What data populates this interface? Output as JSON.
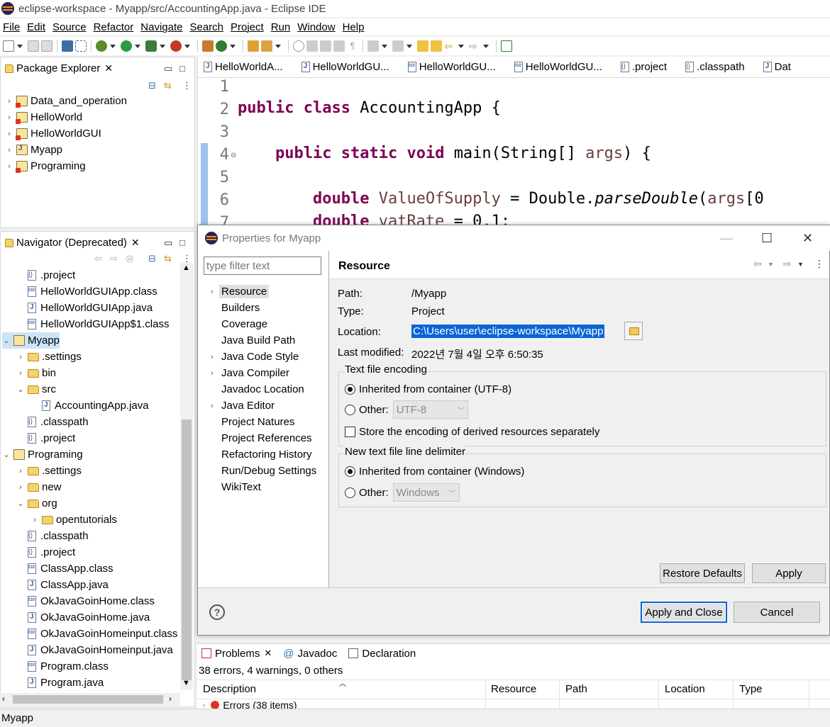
{
  "window": {
    "title": "eclipse-workspace - Myapp/src/AccountingApp.java - Eclipse IDE"
  },
  "menu": [
    "File",
    "Edit",
    "Source",
    "Refactor",
    "Navigate",
    "Search",
    "Project",
    "Run",
    "Window",
    "Help"
  ],
  "package_explorer": {
    "tab_label": "Package Explorer",
    "items": [
      {
        "label": "Data_and_operation",
        "icon": "project-error-icon"
      },
      {
        "label": "HelloWorld",
        "icon": "project-error-icon"
      },
      {
        "label": "HelloWorldGUI",
        "icon": "project-error-icon"
      },
      {
        "label": "Myapp",
        "icon": "java-project-icon"
      },
      {
        "label": "Programing",
        "icon": "project-error-icon"
      }
    ]
  },
  "navigator": {
    "tab_label": "Navigator (Deprecated)",
    "items": [
      {
        "label": ".project",
        "indent": 1,
        "icon": "xml",
        "twisty": ""
      },
      {
        "label": "HelloWorldGUIApp.class",
        "indent": 1,
        "icon": "cls",
        "twisty": ""
      },
      {
        "label": "HelloWorldGUIApp.java",
        "indent": 1,
        "icon": "java",
        "twisty": ""
      },
      {
        "label": "HelloWorldGUIApp$1.class",
        "indent": 1,
        "icon": "cls",
        "twisty": ""
      },
      {
        "label": "Myapp",
        "indent": 0,
        "icon": "project",
        "twisty": "open"
      },
      {
        "label": ".settings",
        "indent": 1,
        "icon": "folder",
        "twisty": "closed"
      },
      {
        "label": "bin",
        "indent": 1,
        "icon": "folder",
        "twisty": "closed"
      },
      {
        "label": "src",
        "indent": 1,
        "icon": "folder",
        "twisty": "open"
      },
      {
        "label": "AccountingApp.java",
        "indent": 2,
        "icon": "java",
        "twisty": ""
      },
      {
        "label": ".classpath",
        "indent": 1,
        "icon": "xml",
        "twisty": ""
      },
      {
        "label": ".project",
        "indent": 1,
        "icon": "xml",
        "twisty": ""
      },
      {
        "label": "Programing",
        "indent": 0,
        "icon": "project",
        "twisty": "open"
      },
      {
        "label": ".settings",
        "indent": 1,
        "icon": "folder",
        "twisty": "closed"
      },
      {
        "label": "new",
        "indent": 1,
        "icon": "folder",
        "twisty": "closed"
      },
      {
        "label": "org",
        "indent": 1,
        "icon": "folder",
        "twisty": "open"
      },
      {
        "label": "opentutorials",
        "indent": 2,
        "icon": "folder",
        "twisty": "closed"
      },
      {
        "label": ".classpath",
        "indent": 1,
        "icon": "xml",
        "twisty": ""
      },
      {
        "label": ".project",
        "indent": 1,
        "icon": "xml",
        "twisty": ""
      },
      {
        "label": "ClassApp.class",
        "indent": 1,
        "icon": "cls",
        "twisty": ""
      },
      {
        "label": "ClassApp.java",
        "indent": 1,
        "icon": "java",
        "twisty": ""
      },
      {
        "label": "OkJavaGoinHome.class",
        "indent": 1,
        "icon": "cls",
        "twisty": ""
      },
      {
        "label": "OkJavaGoinHome.java",
        "indent": 1,
        "icon": "java",
        "twisty": ""
      },
      {
        "label": "OkJavaGoinHomeinput.class",
        "indent": 1,
        "icon": "cls",
        "twisty": ""
      },
      {
        "label": "OkJavaGoinHomeinput.java",
        "indent": 1,
        "icon": "java",
        "twisty": ""
      },
      {
        "label": "Program.class",
        "indent": 1,
        "icon": "cls",
        "twisty": ""
      },
      {
        "label": "Program.java",
        "indent": 1,
        "icon": "java",
        "twisty": ""
      }
    ]
  },
  "editor": {
    "tabs": [
      {
        "label": "HelloWorldA...",
        "icon": "java"
      },
      {
        "label": "HelloWorldGU...",
        "icon": "java"
      },
      {
        "label": "HelloWorldGU...",
        "icon": "cls"
      },
      {
        "label": "HelloWorldGU...",
        "icon": "cls"
      },
      {
        "label": ".project",
        "icon": "xml"
      },
      {
        "label": ".classpath",
        "icon": "xml"
      },
      {
        "label": "Dat",
        "icon": "java"
      }
    ],
    "line_numbers": [
      "1",
      "2",
      "3",
      "4",
      "5",
      "6",
      "7"
    ],
    "line2": {
      "kw1": "public",
      "kw2": "class",
      "rest": "AccountingApp {"
    },
    "line4": {
      "kw1": "public",
      "kw2": "static",
      "kw3": "void",
      "rest1": "main(String[] ",
      "arg": "args",
      "rest2": ") {"
    },
    "line6": {
      "kw": "double",
      "var": "ValueOfSupply",
      "rest1": " = Double.",
      "method": "parseDouble",
      "rest2": "(",
      "arg": "args",
      "rest3": "[0"
    },
    "line7": {
      "kw": "double",
      "var": "vatRate",
      "rest": " = 0.1;"
    }
  },
  "dialog": {
    "title": "Properties for Myapp",
    "filter_placeholder": "type filter text",
    "nav": [
      {
        "label": "Resource",
        "twisty": ">",
        "selected": true
      },
      {
        "label": "Builders",
        "twisty": "",
        "selected": false
      },
      {
        "label": "Coverage",
        "twisty": "",
        "selected": false
      },
      {
        "label": "Java Build Path",
        "twisty": "",
        "selected": false
      },
      {
        "label": "Java Code Style",
        "twisty": ">",
        "selected": false
      },
      {
        "label": "Java Compiler",
        "twisty": ">",
        "selected": false
      },
      {
        "label": "Javadoc Location",
        "twisty": "",
        "selected": false
      },
      {
        "label": "Java Editor",
        "twisty": ">",
        "selected": false
      },
      {
        "label": "Project Natures",
        "twisty": "",
        "selected": false
      },
      {
        "label": "Project References",
        "twisty": "",
        "selected": false
      },
      {
        "label": "Refactoring History",
        "twisty": "",
        "selected": false
      },
      {
        "label": "Run/Debug Settings",
        "twisty": "",
        "selected": false
      },
      {
        "label": "WikiText",
        "twisty": "",
        "selected": false
      }
    ],
    "page_title": "Resource",
    "path_label": "Path:",
    "path_value": "/Myapp",
    "type_label": "Type:",
    "type_value": "Project",
    "location_label": "Location:",
    "location_value": "C:\\Users\\user\\eclipse-workspace\\Myapp",
    "modified_label": "Last modified:",
    "modified_value": "2022년 7월 4일 오후 6:50:35",
    "encoding_group": "Text file encoding",
    "encoding_inherited": "Inherited from container (UTF-8)",
    "encoding_other": "Other:",
    "encoding_other_value": "UTF-8",
    "store_encoding": "Store the encoding of derived resources separately",
    "delimiter_group": "New text file line delimiter",
    "delimiter_inherited": "Inherited from container (Windows)",
    "delimiter_other": "Other:",
    "delimiter_other_value": "Windows",
    "restore_defaults": "Restore Defaults",
    "apply": "Apply",
    "apply_close": "Apply and Close",
    "cancel": "Cancel"
  },
  "problems": {
    "tabs": [
      "Problems",
      "Javadoc",
      "Declaration"
    ],
    "summary": "38 errors, 4 warnings, 0 others",
    "columns": [
      "Description",
      "Resource",
      "Path",
      "Location",
      "Type"
    ],
    "row": "Errors (38 items)"
  },
  "status": {
    "text": "Myapp"
  },
  "colors": {
    "keyword": "#7f0055",
    "selection": "#0a64d6",
    "variable": "#6a3e3e"
  }
}
